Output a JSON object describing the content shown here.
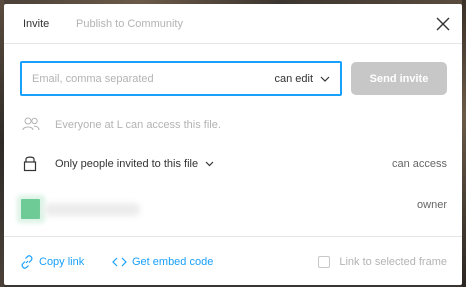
{
  "tabs": [
    {
      "label": "Invite",
      "active": true
    },
    {
      "label": "Publish to Community",
      "active": false
    }
  ],
  "invite": {
    "placeholder": "Email, comma separated",
    "permission": "can edit",
    "send_label": "Send invite"
  },
  "everyone": {
    "text": "Everyone at L can access this file."
  },
  "access": {
    "scope_label": "Only people invited to this file",
    "permission": "can access"
  },
  "member": {
    "role": "owner"
  },
  "footer": {
    "copy_link": "Copy link",
    "embed_code": "Get embed code",
    "frame_label": "Link to selected frame"
  },
  "colors": {
    "accent": "#18a0fb",
    "disabled_button": "#c7c7c7",
    "muted_text": "#b3b3b3",
    "avatar": "#6fcb96"
  }
}
